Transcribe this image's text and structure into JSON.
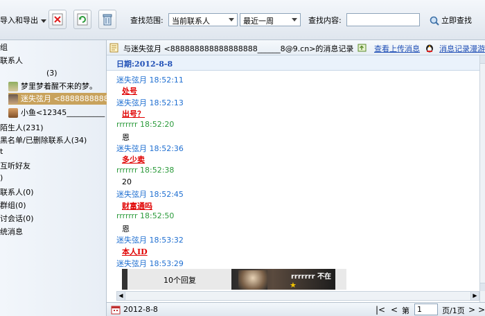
{
  "toolbar": {
    "import_export_label": "导入和导出",
    "search_scope_label": "查找范围:",
    "scope_value": "当前联系人",
    "time_value": "最近一周",
    "search_content_label": "查找内容:",
    "search_content_value": "",
    "search_now_label": "立即查找"
  },
  "sidebar": {
    "groups_heading": "组",
    "contacts_label": "联系人",
    "count_3": "(3)",
    "contacts": [
      {
        "name": "梦里梦着醒不来的梦。"
      },
      {
        "name": "迷失弦月 <8888888888888"
      },
      {
        "name": "小鱼<12345__________"
      }
    ],
    "strangers": "陌生人(231)",
    "blacklist": "黑名单/已删除联系人(34)",
    "blank1": "t",
    "mutual_listen": "互听好友",
    "blank2": ")",
    "other_contacts": "联系人(0)",
    "groups2": "群组(0)",
    "chat_sessions": "讨会话(0)",
    "system_messages": "统消息"
  },
  "header": {
    "title_prefix": "与迷失弦月 <888888888888888888______8@9.cn>的消息记录",
    "view_uploads": "查看上传消息",
    "roaming": "消息记录漫游"
  },
  "date_header": "日期:2012-8-8",
  "messages": [
    {
      "sender": "迷失弦月",
      "time": "18:52:11",
      "text": "处号",
      "style": "red",
      "who": "a"
    },
    {
      "sender": "迷失弦月",
      "time": "18:52:13",
      "text": "出号？",
      "style": "red",
      "who": "a"
    },
    {
      "sender": "rrrrrrr",
      "time": "18:52:20",
      "text": "恩",
      "style": "plain",
      "who": "b"
    },
    {
      "sender": "迷失弦月",
      "time": "18:52:36",
      "text": "多少卖",
      "style": "red",
      "who": "a"
    },
    {
      "sender": "rrrrrrr",
      "time": "18:52:38",
      "text": "20",
      "style": "plain",
      "who": "b"
    },
    {
      "sender": "迷失弦月",
      "time": "18:52:45",
      "text": "财富通吗",
      "style": "red",
      "who": "a"
    },
    {
      "sender": "rrrrrrr",
      "time": "18:52:50",
      "text": "恩",
      "style": "plain",
      "who": "b"
    },
    {
      "sender": "迷失弦月",
      "time": "18:53:32",
      "text": "本人ID",
      "style": "red",
      "who": "a"
    },
    {
      "sender": "迷失弦月",
      "time": "18:53:29",
      "text": "",
      "style": "plain",
      "who": "a"
    }
  ],
  "image_msg": {
    "reply_label": "10个回复",
    "name": "rrrrrrr",
    "status": "不在"
  },
  "bottom": {
    "date": "2012-8-8",
    "page_prefix": "第",
    "page_value": "1",
    "page_suffix": "页/1页"
  },
  "colors": {
    "link": "#1f4fb6",
    "sender_a": "#1f6fd1",
    "sender_b": "#2a9a3a",
    "red_text": "#e00000",
    "selected_row": "#c8a25c"
  }
}
